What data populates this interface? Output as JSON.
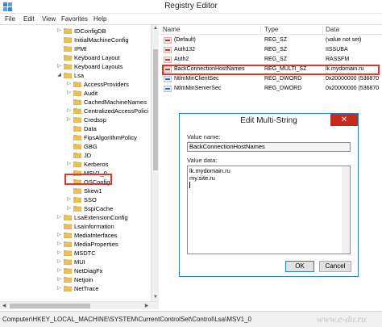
{
  "window": {
    "title": "Registry Editor"
  },
  "menu": [
    "File",
    "Edit",
    "View",
    "Favorites",
    "Help"
  ],
  "tree": [
    {
      "label": "IDConfigDB",
      "level": 0,
      "expander": "closed"
    },
    {
      "label": "InitialMachineConfig",
      "level": 0,
      "expander": "none"
    },
    {
      "label": "IPMI",
      "level": 0,
      "expander": "none"
    },
    {
      "label": "Keyboard Layout",
      "level": 0,
      "expander": "none"
    },
    {
      "label": "Keyboard Layouts",
      "level": 0,
      "expander": "closed"
    },
    {
      "label": "Lsa",
      "level": 0,
      "expander": "open"
    },
    {
      "label": "AccessProviders",
      "level": 1,
      "expander": "closed"
    },
    {
      "label": "Audit",
      "level": 1,
      "expander": "closed"
    },
    {
      "label": "CachedMachineNames",
      "level": 1,
      "expander": "none"
    },
    {
      "label": "CentralizedAccessPolici",
      "level": 1,
      "expander": "closed"
    },
    {
      "label": "Credssp",
      "level": 1,
      "expander": "closed"
    },
    {
      "label": "Data",
      "level": 1,
      "expander": "none"
    },
    {
      "label": "FipsAlgorithmPolicy",
      "level": 1,
      "expander": "none"
    },
    {
      "label": "GBG",
      "level": 1,
      "expander": "none"
    },
    {
      "label": "JD",
      "level": 1,
      "expander": "none"
    },
    {
      "label": "Kerberos",
      "level": 1,
      "expander": "closed"
    },
    {
      "label": "MSV1_0",
      "level": 1,
      "expander": "none",
      "selected": true
    },
    {
      "label": "OSConfig",
      "level": 1,
      "expander": "none"
    },
    {
      "label": "Skew1",
      "level": 1,
      "expander": "none"
    },
    {
      "label": "SSO",
      "level": 1,
      "expander": "closed"
    },
    {
      "label": "SspiCache",
      "level": 1,
      "expander": "closed"
    },
    {
      "label": "LsaExtensionConfig",
      "level": 0,
      "expander": "closed"
    },
    {
      "label": "LsaInformation",
      "level": 0,
      "expander": "none"
    },
    {
      "label": "MediaInterfaces",
      "level": 0,
      "expander": "closed"
    },
    {
      "label": "MediaProperties",
      "level": 0,
      "expander": "closed"
    },
    {
      "label": "MSDTC",
      "level": 0,
      "expander": "closed"
    },
    {
      "label": "MUI",
      "level": 0,
      "expander": "closed"
    },
    {
      "label": "NetDiagFx",
      "level": 0,
      "expander": "closed"
    },
    {
      "label": "Netjoin",
      "level": 0,
      "expander": "closed"
    },
    {
      "label": "NetTrace",
      "level": 0,
      "expander": "closed"
    }
  ],
  "list": {
    "columns": [
      "Name",
      "Type",
      "Data"
    ],
    "rows": [
      {
        "name": "(Default)",
        "type": "REG_SZ",
        "data": "(value not set)",
        "kind": "sz"
      },
      {
        "name": "Auth132",
        "type": "REG_SZ",
        "data": "IISSUBA",
        "kind": "sz"
      },
      {
        "name": "Auth2",
        "type": "REG_SZ",
        "data": "RASSFM",
        "kind": "sz"
      },
      {
        "name": "BackConnectionHostNames",
        "type": "REG_MULTI_SZ",
        "data": "lk.mydomain.ru",
        "kind": "sz"
      },
      {
        "name": "NtlmMinClientSec",
        "type": "REG_DWORD",
        "data": "0x20000000 (536870",
        "kind": "dword"
      },
      {
        "name": "NtlmMinServerSec",
        "type": "REG_DWORD",
        "data": "0x20000000 (536870",
        "kind": "dword"
      }
    ]
  },
  "dialog": {
    "title": "Edit Multi-String",
    "value_name_label": "Value name:",
    "value_name": "BackConnectionHostNames",
    "value_data_label": "Value data:",
    "value_data_lines": [
      "lk.mydomain.ru",
      "my.site.ru"
    ],
    "ok_label": "OK",
    "cancel_label": "Cancel",
    "close_glyph": "✕"
  },
  "status": {
    "path": "Computer\\HKEY_LOCAL_MACHINE\\SYSTEM\\CurrentControlSet\\Control\\Lsa\\MSV1_0"
  },
  "watermark": "www.e-du.ru",
  "colors": {
    "highlight": "#e0362c",
    "folder": "#e8c15a",
    "dialog_border": "#2b7bd3",
    "close_button": "#c7291c"
  }
}
